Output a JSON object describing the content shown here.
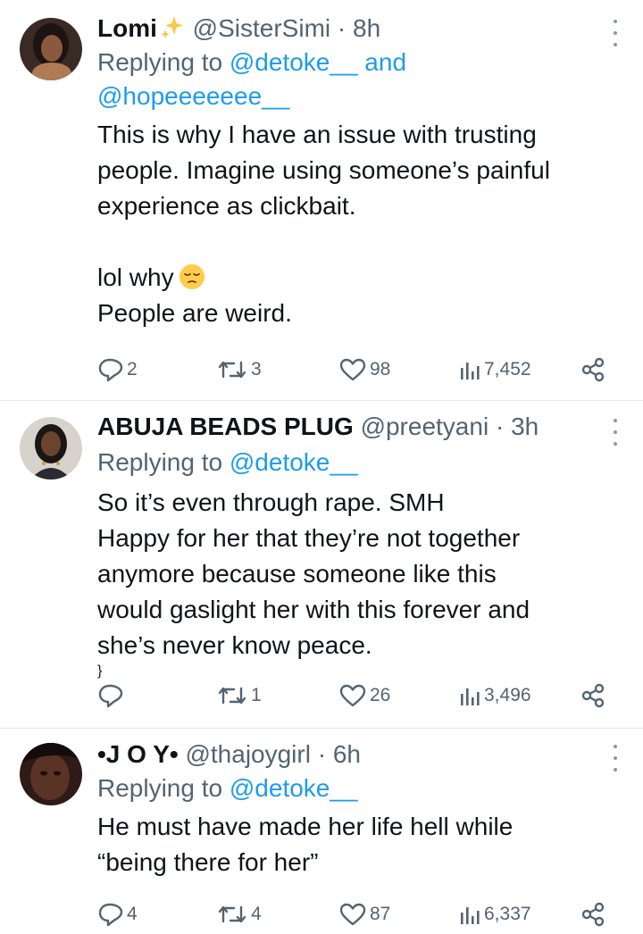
{
  "colors": {
    "text": "#0f1419",
    "secondary": "#536471",
    "mention": "#1d9bf0",
    "divider": "#e6e9eb"
  },
  "tweets": [
    {
      "name": "Lomi",
      "name_emoji": "sparkles-icon",
      "handle": "@SisterSimi",
      "time": "8h",
      "replying_prefix": "Replying to",
      "mentions": [
        "@detoke__",
        "@hopeeeeeee__"
      ],
      "mention_joiner": "and",
      "body_lines": [
        "This is why I have an issue with trusting",
        "people. Imagine using someone’s painful",
        "experience as clickbait."
      ],
      "body_lines_2": [
        "lol why",
        "People are weird."
      ],
      "body_emoji": "pensive-face-icon",
      "stats": {
        "replies": "2",
        "retweets": "3",
        "likes": "98",
        "views": "7,452"
      }
    },
    {
      "name": "ABUJA BEADS PLUG",
      "handle": "@preetyani",
      "time": "3h",
      "replying_prefix": "Replying to",
      "mentions": [
        "@detoke__"
      ],
      "body_lines": [
        "So it’s even through rape. SMH",
        "Happy for her that they’re not together",
        "anymore because someone like this",
        "would gaslight her with this forever and",
        "she’s never know peace."
      ],
      "stats": {
        "replies": "",
        "retweets": "1",
        "likes": "26",
        "views": "3,496"
      }
    },
    {
      "name": "•J O Y•",
      "handle": "@thajoygirl",
      "time": "6h",
      "replying_prefix": "Replying to",
      "mentions": [
        "@detoke__"
      ],
      "body_lines": [
        "He must have made her life hell while",
        "“being there for her”"
      ],
      "stats": {
        "replies": "4",
        "retweets": "4",
        "likes": "87",
        "views": "6,337"
      }
    }
  ]
}
